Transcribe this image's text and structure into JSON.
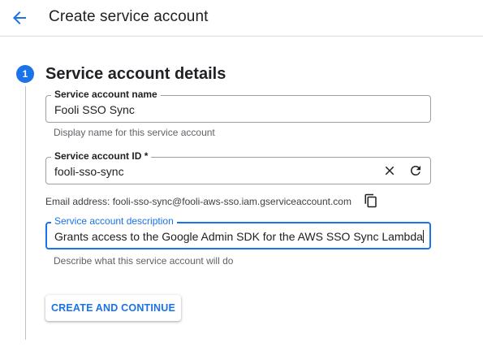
{
  "header": {
    "back_icon": "arrow-back-icon",
    "title": "Create service account"
  },
  "step": {
    "number": "1",
    "title": "Service account details"
  },
  "form": {
    "name": {
      "label": "Service account name",
      "value": "Fooli SSO Sync",
      "hint": "Display name for this service account"
    },
    "id": {
      "label": "Service account ID *",
      "value": "fooli-sso-sync",
      "clear_icon": "close-icon",
      "refresh_icon": "refresh-icon"
    },
    "email": {
      "text": "Email address: fooli-sso-sync@fooli-aws-sso.iam.gserviceaccount.com",
      "copy_icon": "copy-icon"
    },
    "description": {
      "label": "Service account description",
      "value": "Grants access to the Google Admin SDK for the AWS SSO Sync Lambda",
      "hint": "Describe what this service account will do"
    }
  },
  "actions": {
    "create_label": "CREATE AND CONTINUE"
  },
  "colors": {
    "accent": "#1a73e8",
    "text": "#202124",
    "hint": "#5f6368",
    "border": "#9aa0a6"
  }
}
